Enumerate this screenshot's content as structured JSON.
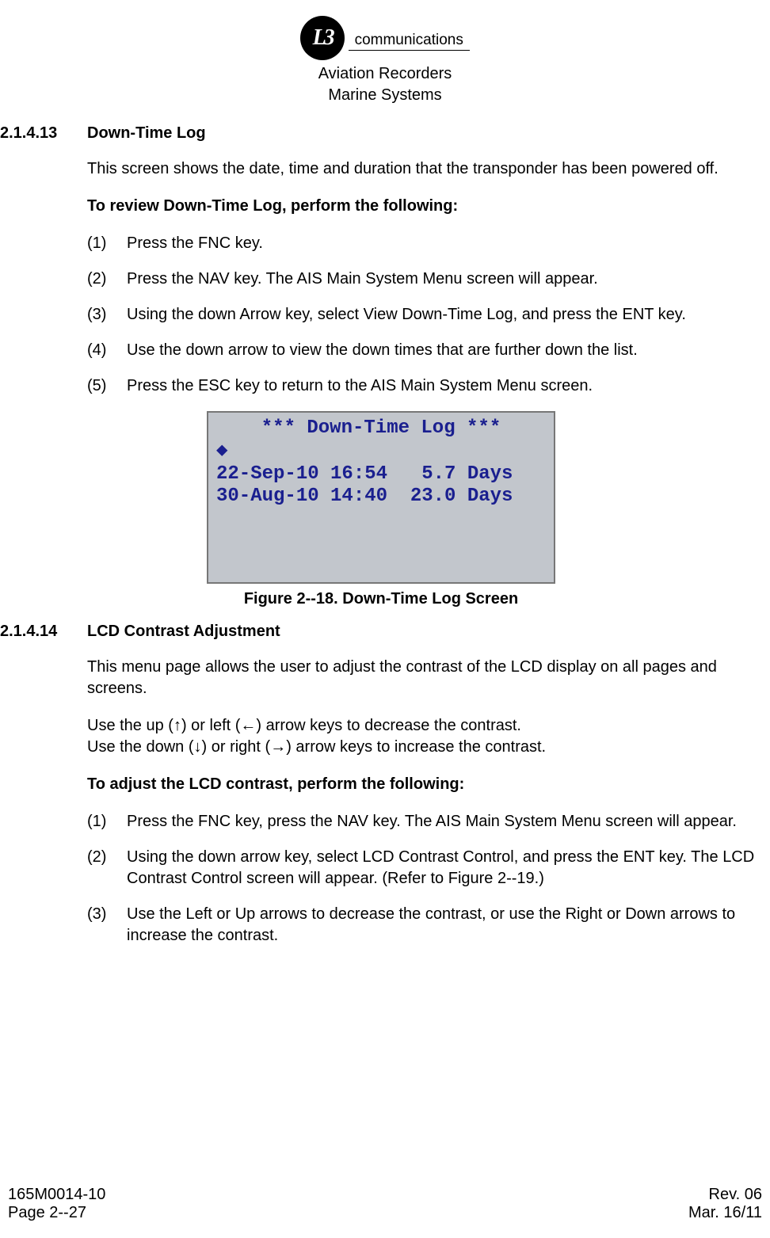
{
  "logo": {
    "mark": "L3",
    "sub": "communications",
    "line1": "Aviation Recorders",
    "line2": "Marine Systems"
  },
  "sec1": {
    "num": "2.1.4.13",
    "title": "Down-Time Log",
    "intro": "This screen shows the date, time and duration that the transponder has been powered off.",
    "instruct": "To review Down-Time Log, perform the following:",
    "steps": [
      "Press the FNC  key.",
      "Press the NAV key. The AIS Main System Menu screen will appear.",
      "Using the down Arrow key, select View Down-Time Log, and press the ENT key.",
      "Use the down arrow to view the down times that are further down the list.",
      "Press the ESC key to return to the AIS Main System Menu screen."
    ]
  },
  "figure": {
    "title": "*** Down-Time Log ***",
    "rows": [
      "22-Sep-10 16:54   5.7 Days",
      "30-Aug-10 14:40  23.0 Days"
    ],
    "caption": "Figure 2--18.  Down-Time Log Screen"
  },
  "sec2": {
    "num": "2.1.4.14",
    "title": "LCD Contrast Adjustment",
    "intro": "This menu page allows the user to adjust the contrast of the LCD display on all pages and screens.",
    "arrows1": "Use the up (↑) or left (←) arrow keys to decrease the contrast.",
    "arrows2": "Use the down (↓) or right (→) arrow keys to increase the contrast.",
    "instruct": "To adjust the LCD contrast, perform the following:",
    "steps": [
      "Press the FNC  key, press the NAV key. The AIS Main System Menu screen will appear.",
      "Using the down arrow key, select LCD Contrast Control, and press the ENT key. The LCD Contrast Control screen will appear. (Refer to Figure 2--19.)",
      "Use the Left or Up arrows to decrease the contrast, or use the Right or Down arrows to increase the contrast."
    ]
  },
  "footer": {
    "doc": "165M0014-10",
    "page": "Page 2--27",
    "rev": "Rev. 06",
    "date": "Mar. 16/11"
  }
}
